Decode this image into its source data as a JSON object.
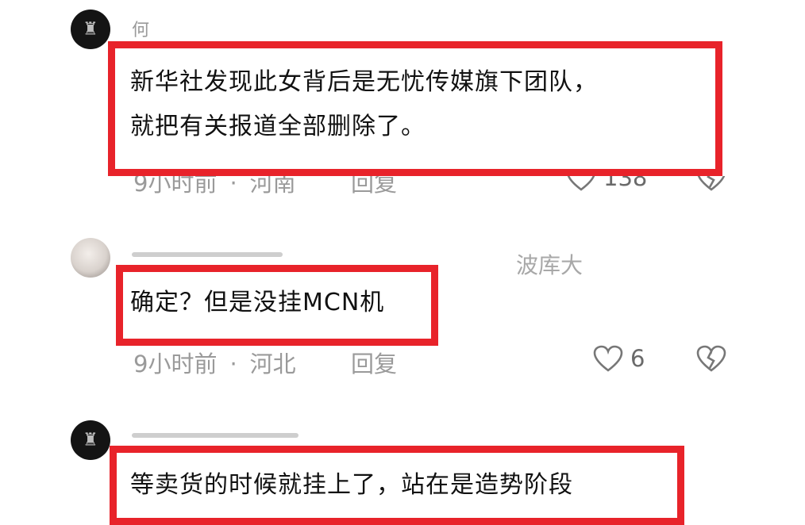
{
  "comments": [
    {
      "username": "何",
      "text_line1": "新华社发现此女背后是无忧传媒旗下团队，",
      "text_line2": "就把有关报道全部删除了。",
      "time": "9小时前",
      "location": "河南",
      "reply": "回复",
      "likes": "138"
    },
    {
      "username_suffix": "波库大",
      "text": "确定？但是没挂MCN机",
      "time": "9小时前",
      "location": "河北",
      "reply": "回复",
      "likes": "6"
    },
    {
      "text": "等卖货的时候就挂上了，站在是造势阶段"
    }
  ],
  "icons": {
    "like": "heart-outline-icon",
    "dislike": "broken-heart-icon"
  },
  "colors": {
    "highlight": "#e8232a",
    "meta": "#9a9a9a"
  }
}
